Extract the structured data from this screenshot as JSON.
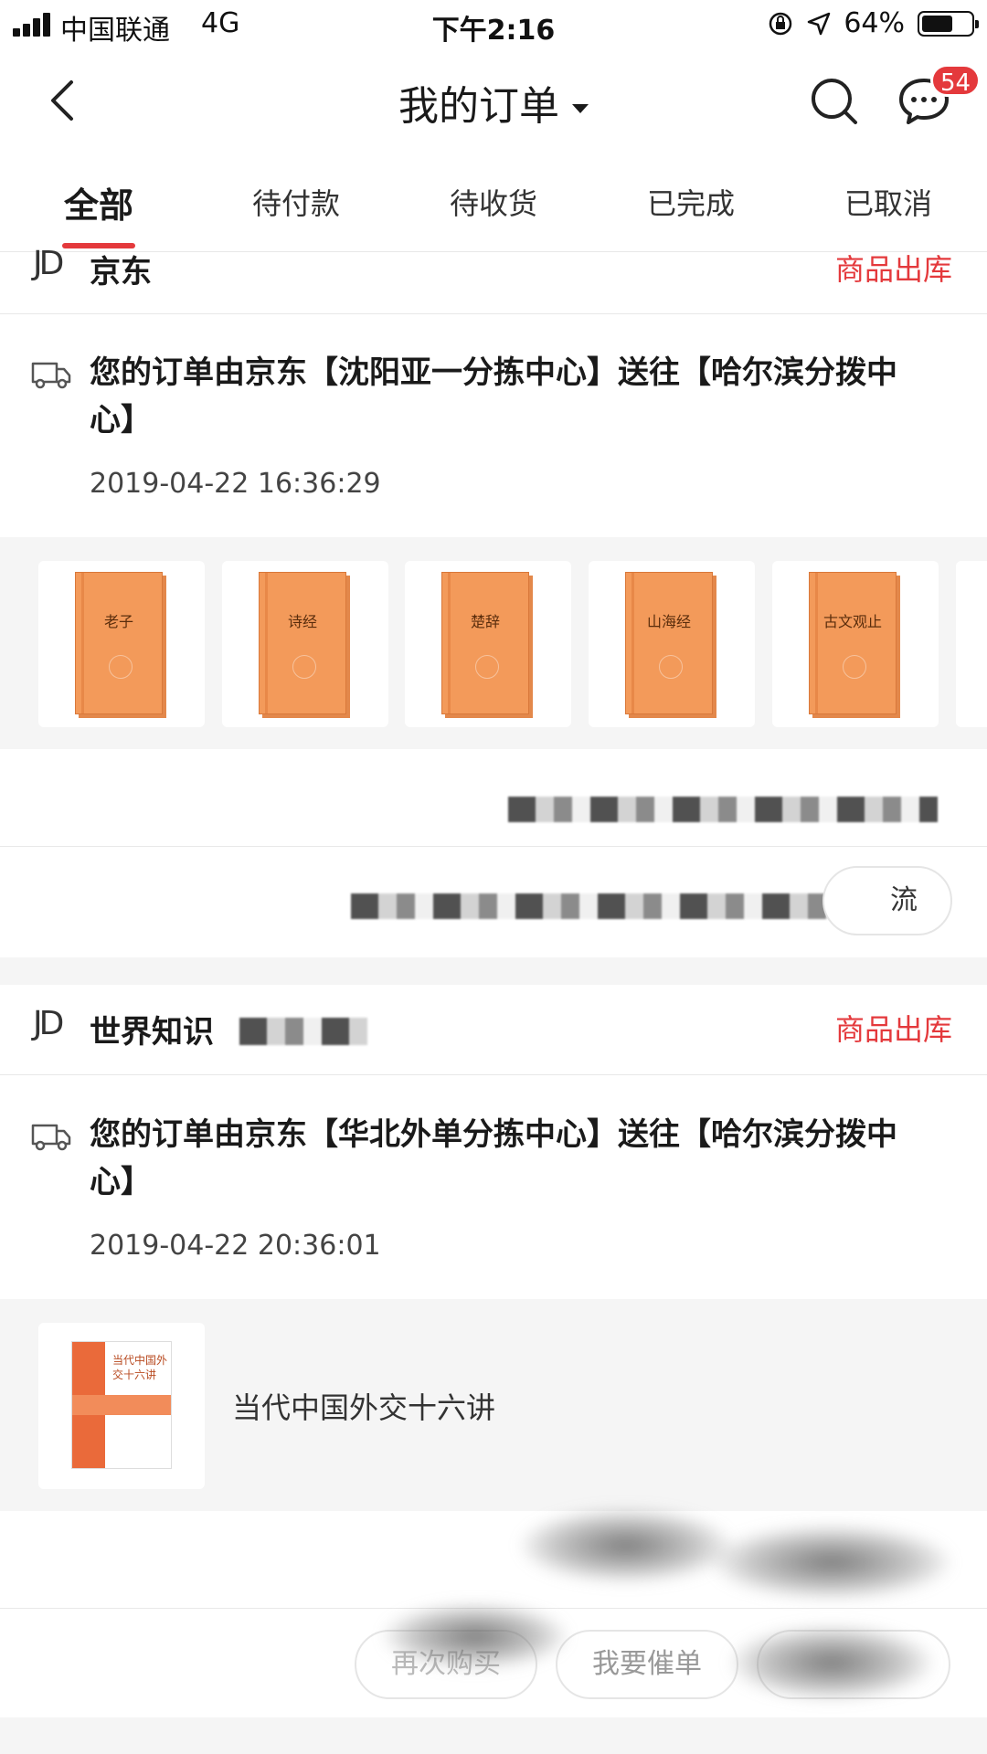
{
  "status_bar": {
    "carrier": "中国联通",
    "network": "4G",
    "time": "下午2:16",
    "battery": "64%",
    "battery_level": 0.64
  },
  "nav": {
    "title": "我的订单",
    "message_count": "54"
  },
  "tabs": [
    {
      "label": "全部",
      "active": true
    },
    {
      "label": "待付款",
      "active": false
    },
    {
      "label": "待收货",
      "active": false
    },
    {
      "label": "已完成",
      "active": false
    },
    {
      "label": "已取消",
      "active": false
    }
  ],
  "orders": [
    {
      "shop_logo": "JD",
      "shop_name": "京东",
      "status": "商品出库",
      "tracking": "您的订单由京东【沈阳亚一分拣中心】送往【哈尔滨分拨中心】",
      "tracking_time": "2019-04-22 16:36:29",
      "goods": [
        {
          "title": "老子"
        },
        {
          "title": "诗经"
        },
        {
          "title": "楚辞"
        },
        {
          "title": "山海经"
        },
        {
          "title": "古文观止"
        }
      ],
      "button_suffix": "流"
    },
    {
      "shop_logo": "JD",
      "shop_name": "世界知识",
      "status": "商品出库",
      "tracking": "您的订单由京东【华北外单分拣中心】送往【哈尔滨分拨中心】",
      "tracking_time": "2019-04-22 20:36:01",
      "goods_name": "当代中国外交十六讲",
      "goods_cover_title": "当代中国外交十六讲",
      "buttons": [
        "再次购买",
        "我要催单"
      ]
    }
  ]
}
